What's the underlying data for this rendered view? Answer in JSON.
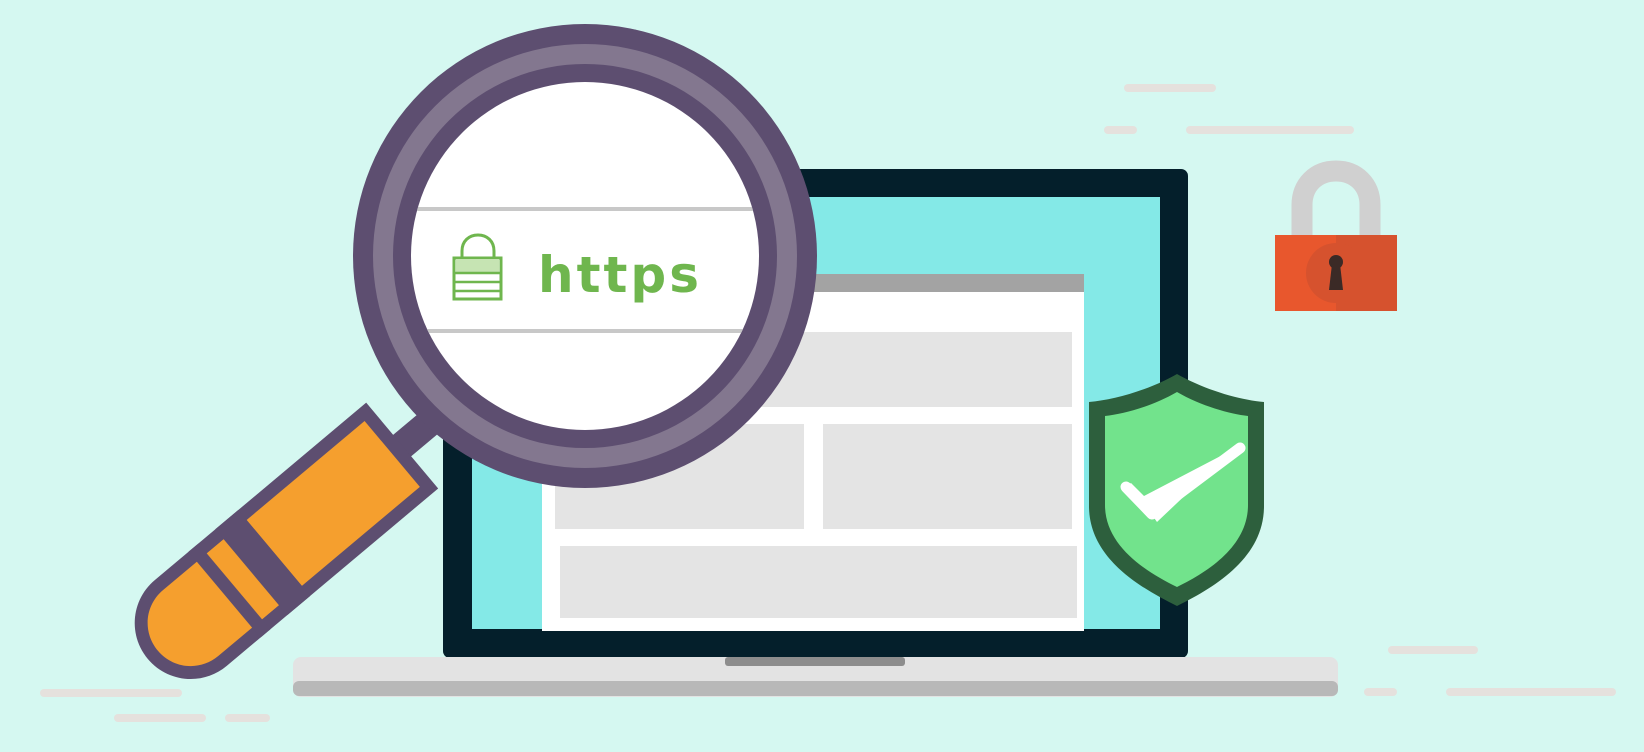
{
  "address_bar": {
    "protocol_label": "https",
    "icon": "padlock-icon"
  },
  "icons": {
    "magnifier": "magnifying-glass-icon",
    "laptop": "laptop-icon",
    "shield": "shield-check-icon",
    "padlock": "padlock-icon"
  },
  "colors": {
    "background": "#d5f8f1",
    "https_green": "#6fb64e",
    "magnifier_rim": "#5d4e70",
    "magnifier_rim_light": "#83778f",
    "handle_orange": "#f59f2e",
    "laptop_frame": "#041f2b",
    "laptop_screen": "#84e9e7",
    "shield_green": "#72e38c",
    "shield_border": "#2d5f3d",
    "padlock_body": "#e8572d",
    "padlock_shackle": "#d0d0d0"
  }
}
